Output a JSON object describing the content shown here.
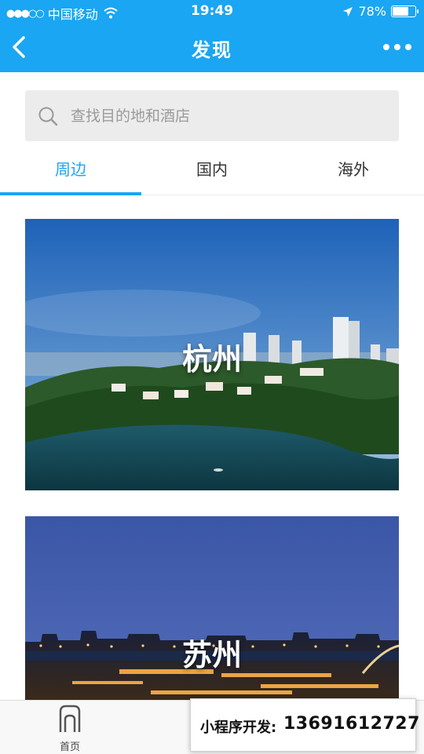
{
  "status_bar": {
    "carrier": "中国移动",
    "time": "19:49",
    "battery": "78%",
    "battery_level": 0.78
  },
  "nav": {
    "title": "发现"
  },
  "search": {
    "placeholder": "查找目的地和酒店"
  },
  "tabs": [
    {
      "label": "周边",
      "active": true
    },
    {
      "label": "国内",
      "active": false
    },
    {
      "label": "海外",
      "active": false
    }
  ],
  "cards": [
    {
      "city": "杭州"
    },
    {
      "city": "苏州"
    }
  ],
  "tabbar": {
    "home_label": "首页"
  },
  "banner": {
    "prefix": "小程序开发:",
    "phone": "13691612727"
  },
  "colors": {
    "accent": "#1aa6f2"
  }
}
